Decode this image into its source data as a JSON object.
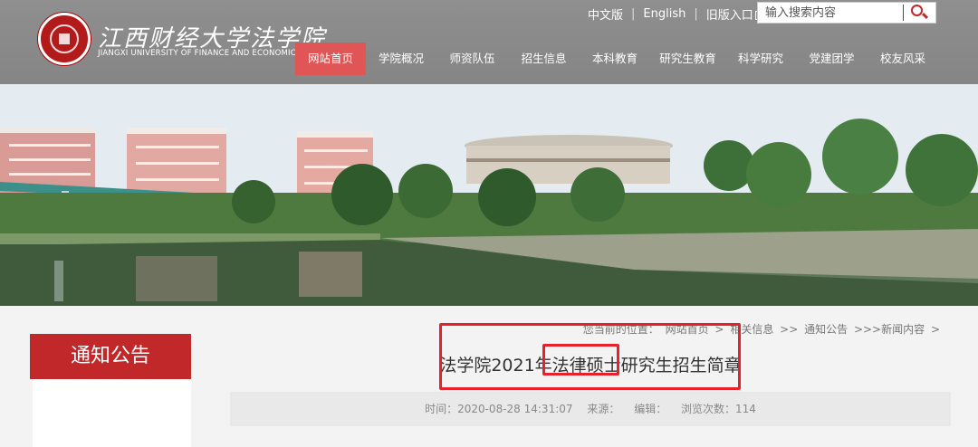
{
  "header": {
    "logo_cn": "江西财经大学法学院",
    "logo_en": "JIANGXI UNIVERSITY OF FINANCE AND ECONOMICS",
    "top_links": {
      "chinese": "中文版",
      "english": "English",
      "old_version": "旧版入口",
      "separator": "|"
    },
    "search_placeholder": "输入搜索内容",
    "nav": [
      {
        "label": "网站首页",
        "active": true
      },
      {
        "label": "学院概况"
      },
      {
        "label": "师资队伍"
      },
      {
        "label": "招生信息"
      },
      {
        "label": "本科教育"
      },
      {
        "label": "研究生教育"
      },
      {
        "label": "科学研究"
      },
      {
        "label": "党建团学"
      },
      {
        "label": "校友风采"
      }
    ]
  },
  "sidebar": {
    "title": "通知公告"
  },
  "breadcrumb": {
    "prefix": "您当前的位置：",
    "items": [
      "网站首页",
      ">",
      "相关信息",
      ">>",
      "通知公告",
      ">>>新闻内容",
      ">"
    ]
  },
  "article": {
    "title": "法学院2021年法律硕士研究生招生简章",
    "time_label": "时间：2020-08-28 14:31:07",
    "source_label": "来源：",
    "editor_label": "编辑：",
    "views_label": "浏览次数：114"
  },
  "colors": {
    "header_bg": "#8a8a8a",
    "nav_active": "#e05555",
    "accent_red": "#c0282a",
    "annotation_red": "#e8202a"
  },
  "icons": {
    "search": "magnifier-icon",
    "seal": "university-seal-icon"
  }
}
